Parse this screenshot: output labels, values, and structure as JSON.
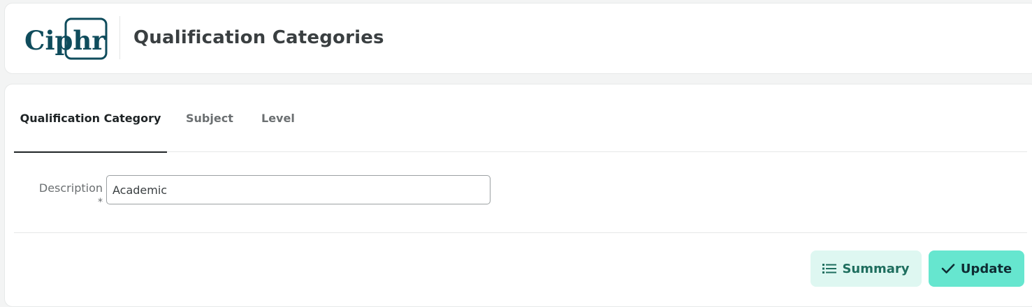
{
  "header": {
    "logo_text": "Ciphr",
    "title": "Qualification Categories"
  },
  "tabs": [
    {
      "label": "Qualification Category",
      "active": true
    },
    {
      "label": "Subject",
      "active": false
    },
    {
      "label": "Level",
      "active": false
    }
  ],
  "form": {
    "description_label": "Description",
    "required_marker": "*",
    "description_value": "Academic"
  },
  "actions": {
    "summary_label": "Summary",
    "summary_icon": "list-icon",
    "update_label": "Update",
    "update_icon": "check-icon"
  },
  "colors": {
    "brand": "#0f4c5c",
    "update_bg": "#66e6cf",
    "summary_bg": "#def7f1",
    "summary_text": "#1e6e5e"
  }
}
